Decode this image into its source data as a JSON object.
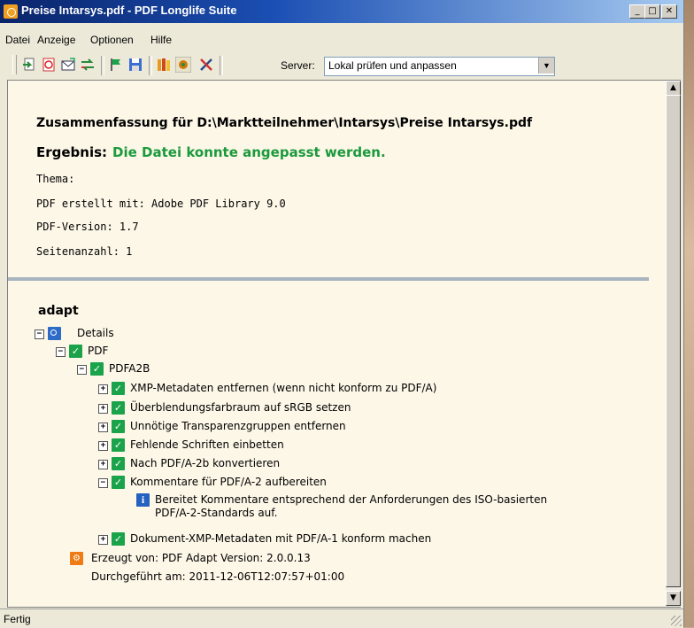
{
  "window": {
    "title": "Preise Intarsys.pdf - PDF Longlife Suite"
  },
  "menu": [
    {
      "label": "Datei"
    },
    {
      "label": "Anzeige"
    },
    {
      "label": "Optionen"
    },
    {
      "label": "Hilfe"
    }
  ],
  "toolbar": {
    "icons": [
      "import-icon",
      "pdf-icon",
      "mail-icon",
      "convert-icon",
      "flag-icon",
      "save-icon",
      "books-icon",
      "gear-icon",
      "tools-icon"
    ],
    "server_label": "Server:",
    "server_value": "Lokal prüfen und anpassen"
  },
  "summary": {
    "title": "Zusammenfassung für D:\\Marktteilnehmer\\Intarsys\\Preise Intarsys.pdf",
    "result_label": "Ergebnis:",
    "result_value": "Die Datei konnte angepasst werden.",
    "theme": "Thema:",
    "creator": "PDF erstellt mit: Adobe PDF Library 9.0",
    "version": "PDF-Version: 1.7",
    "pages": "Seitenanzahl: 1"
  },
  "adapt": {
    "heading": "adapt",
    "tree": [
      {
        "label": "Details",
        "exp": "−",
        "icon": "details"
      },
      {
        "label": "PDF",
        "exp": "−",
        "icon": "ok"
      },
      {
        "label": "PDFA2B",
        "exp": "−",
        "icon": "ok"
      },
      {
        "label": "XMP-Metadaten entfernen (wenn nicht konform zu PDF/A)",
        "exp": "+",
        "icon": "ok"
      },
      {
        "label": "Überblendungsfarbraum auf sRGB setzen",
        "exp": "+",
        "icon": "ok"
      },
      {
        "label": "Unnötige Transparenzgruppen entfernen",
        "exp": "+",
        "icon": "ok"
      },
      {
        "label": "Fehlende Schriften einbetten",
        "exp": "+",
        "icon": "ok"
      },
      {
        "label": "Nach PDF/A-2b konvertieren",
        "exp": "+",
        "icon": "ok"
      },
      {
        "label": "Kommentare für PDF/A-2 aufbereiten",
        "exp": "−",
        "icon": "ok"
      },
      {
        "label": "Bereitet Kommentare entsprechend der Anforderungen des ISO-basierten",
        "icon": "info"
      },
      {
        "label": "PDF/A-2-Standards auf."
      },
      {
        "label": "Dokument-XMP-Metadaten mit PDF/A-1 konform machen",
        "exp": "+",
        "icon": "ok"
      },
      {
        "label": "Erzeugt von: PDF Adapt Version: 2.0.0.13",
        "icon": "gear"
      },
      {
        "label": "Durchgeführt am: 2011-12-06T12:07:57+01:00"
      }
    ]
  },
  "status": {
    "text": "Fertig"
  }
}
